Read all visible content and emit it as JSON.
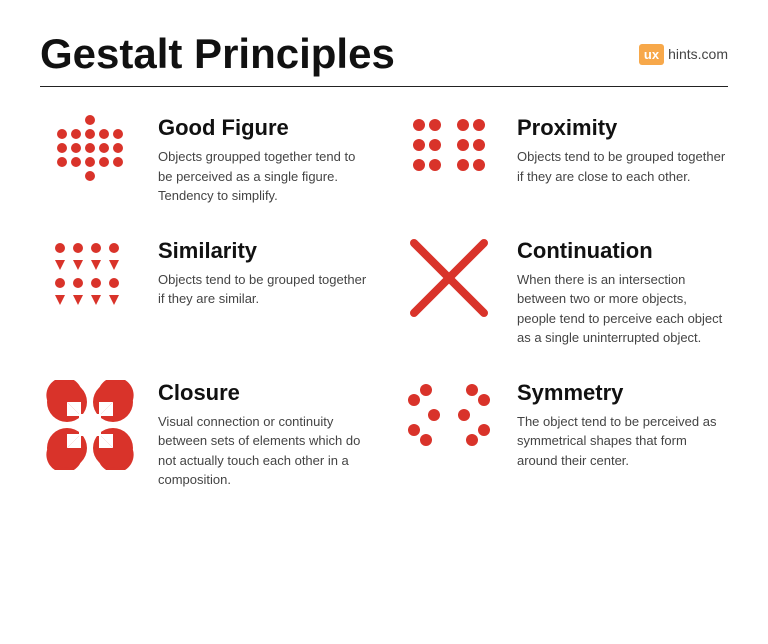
{
  "header": {
    "title": "Gestalt Principles",
    "logo_ux": "ux",
    "logo_domain": "hints.com"
  },
  "principles": [
    {
      "id": "good-figure",
      "title": "Good Figure",
      "description": "Objects groupped together tend to be perceived as a single figure. Tendency to simplify.",
      "col": 0
    },
    {
      "id": "proximity",
      "title": "Proximity",
      "description": "Objects tend to be grouped together if they are close to each other.",
      "col": 1
    },
    {
      "id": "similarity",
      "title": "Similarity",
      "description": "Objects tend to be grouped together if they are similar.",
      "col": 0
    },
    {
      "id": "continuation",
      "title": "Continuation",
      "description": "When there is an intersection between two or more objects, people tend to perceive each object as a single uninterrupted object.",
      "col": 1
    },
    {
      "id": "closure",
      "title": "Closure",
      "description": "Visual connection or continuity between sets of elements which do not actually touch each other in a composition.",
      "col": 0
    },
    {
      "id": "symmetry",
      "title": "Symmetry",
      "description": "The object tend to be perceived as symmetrical shapes that form around their center.",
      "col": 1
    }
  ],
  "colors": {
    "accent": "#d9332a",
    "text_dark": "#111111",
    "text_light": "#444444",
    "logo_bg": "#f7a84a"
  }
}
